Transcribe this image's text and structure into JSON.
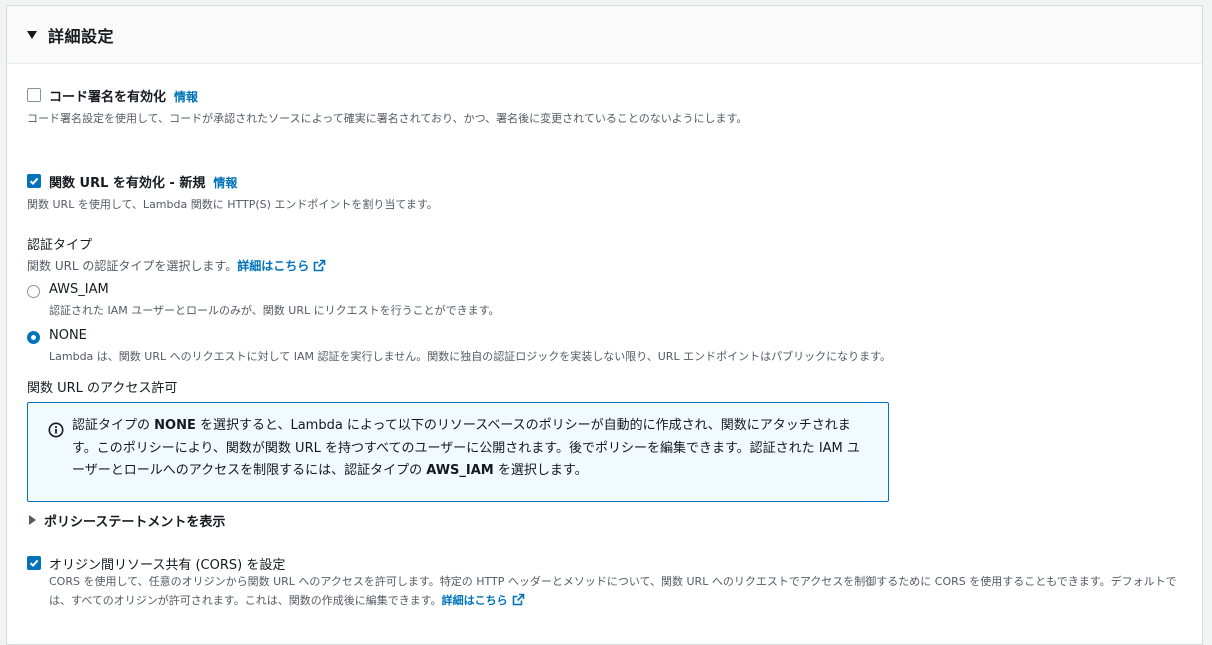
{
  "panel": {
    "title": "詳細設定"
  },
  "code_signing": {
    "label": "コード署名を有効化",
    "info": "情報",
    "description": "コード署名設定を使用して、コードが承認されたソースによって確実に署名されており、かつ、署名後に変更されていることのないようにします。",
    "checked": false
  },
  "function_url": {
    "label": "関数 URL を有効化 - 新規",
    "info": "情報",
    "description": "関数 URL を使用して、Lambda 関数に HTTP(S) エンドポイントを割り当てます。",
    "checked": true
  },
  "auth_type": {
    "heading": "認証タイプ",
    "description": "関数 URL の認証タイプを選択します。",
    "learn_more": "詳細はこちら",
    "options": [
      {
        "label": "AWS_IAM",
        "description": "認証された IAM ユーザーとロールのみが、関数 URL にリクエストを行うことができます。",
        "selected": false
      },
      {
        "label": "NONE",
        "description": "Lambda は、関数 URL へのリクエストに対して IAM 認証を実行しません。関数に独自の認証ロジックを実装しない限り、URL エンドポイントはパブリックになります。",
        "selected": true
      }
    ]
  },
  "permissions": {
    "heading": "関数 URL のアクセス許可",
    "alert": {
      "p1": "認証タイプの ",
      "b1": "NONE",
      "p2": " を選択すると、Lambda によって以下のリソースベースのポリシーが自動的に作成され、関数にアタッチされます。このポリシーにより、関数が関数 URL を持つすべてのユーザーに公開されます。後でポリシーを編集できます。認証された IAM ユーザーとロールへのアクセスを制限するには、認証タイプの ",
      "b2": "AWS_IAM",
      "p3": " を選択します。"
    },
    "policy_toggle": "ポリシーステートメントを表示"
  },
  "cors": {
    "label": "オリジン間リソース共有 (CORS) を設定",
    "description": "CORS を使用して、任意のオリジンから関数 URL へのアクセスを許可します。特定の HTTP ヘッダーとメソッドについて、関数 URL へのリクエストでアクセスを制御するために CORS を使用することもできます。デフォルトでは、すべてのオリジンが許可されます。これは、関数の作成後に編集できます。",
    "learn_more": "詳細はこちら",
    "checked": true
  },
  "colors": {
    "accent": "#0073bb",
    "info_bg": "#f1faff"
  }
}
